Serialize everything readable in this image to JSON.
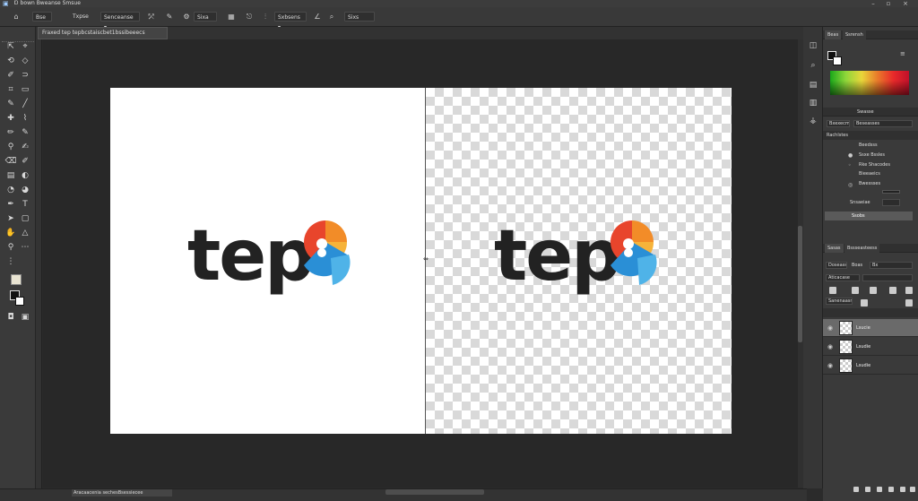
{
  "app": {
    "title": "Ɒ bown Bweanse Smsue"
  },
  "options_bar": {
    "items": [
      {
        "label": "Bse",
        "icon": "brush-icon"
      },
      {
        "label": "Txpse"
      },
      {
        "label": "Senceanse"
      },
      {
        "label": "Sixa"
      },
      {
        "label": "Sxbsens"
      },
      {
        "label": "Sixs"
      }
    ]
  },
  "document": {
    "tab_title": "Fraxed tep tepbcstaiscbet1bssibeeecs",
    "logo_text": "tep",
    "logo_colors": {
      "orange": "#f28c28",
      "red": "#e8452c",
      "yellow": "#f6b33a",
      "blue": "#2a8fd6",
      "light_blue": "#4fb3e8"
    }
  },
  "status_bar": {
    "field": "Aracaacenia sechesBsessiecee"
  },
  "panels": {
    "color": {
      "tabs": [
        "Beas",
        "Ssrensh"
      ],
      "foreground": "#111111",
      "background": "#ffffff"
    },
    "properties": {
      "header": "Swasse",
      "row1": [
        "Bxexecm",
        "Beseasses"
      ],
      "section": "Rachlstes",
      "items": [
        "Beedsss",
        "Ssxe Bssles",
        "Rke Shacodes",
        "Bieeaeics",
        "Bwessses",
        "Snsaeiae"
      ],
      "active_item_value": "Ssobs"
    },
    "layers": {
      "tabs": [
        "Sasas",
        "Bssseasteess"
      ],
      "blend_mode": "Doseasse",
      "opacity_label": "Boas",
      "opacity_value": "Bx",
      "lock_label": "Aticacase",
      "fill_label": "Sanenaasn",
      "items": [
        {
          "name": "Lsucie",
          "selected": true
        },
        {
          "name": "Lsudie",
          "selected": false
        },
        {
          "name": "Lsudie",
          "selected": false
        }
      ]
    }
  }
}
